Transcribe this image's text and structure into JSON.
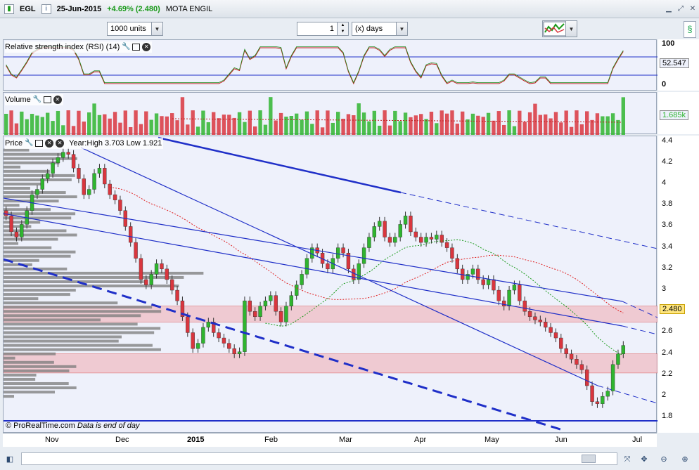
{
  "titlebar": {
    "symbol": "EGL",
    "date": "25-Jun-2015",
    "change": "+4.69% (2.480)",
    "name": "MOTA ENGIL",
    "info_icon": "i"
  },
  "toolbar": {
    "units_label": "1000 units",
    "period_value": "1",
    "period_unit": "(x) days"
  },
  "rsi": {
    "title": "Relative strength index (RSI) (14)",
    "axis_top": "100",
    "axis_bottom": "0",
    "current": "52.547"
  },
  "volume": {
    "title": "Volume",
    "current": "1.685k"
  },
  "price": {
    "title": "Price",
    "year_range": "Year:High 3.703 Low 1.921",
    "current": "2.480",
    "ticks": [
      "4.4",
      "4.2",
      "4",
      "3.8",
      "3.6",
      "3.4",
      "3.2",
      "3",
      "2.8",
      "2.6",
      "2.4",
      "2.2",
      "2",
      "1.8"
    ]
  },
  "footnote": {
    "source": "© ProRealTime.com",
    "note": "Data is end of day"
  },
  "xaxis": {
    "labels": [
      "Nov",
      "Dec",
      "2015",
      "Feb",
      "Mar",
      "Apr",
      "May",
      "Jun",
      "Jul"
    ]
  },
  "colors": {
    "up": "#2fb52f",
    "down": "#d9363e",
    "trend": "#1f2fc8",
    "zone": "#f0c4cc",
    "profile": "#7a7a7a"
  },
  "chart_data": {
    "type": "candlestick",
    "y_range": [
      1.65,
      4.45
    ],
    "levels": [
      2.85,
      2.7,
      2.4,
      2.22
    ],
    "year_high": 3.703,
    "year_low": 1.921,
    "last": 2.48,
    "closes": [
      3.7,
      3.55,
      3.5,
      3.62,
      3.75,
      3.9,
      3.95,
      4.05,
      4.1,
      4.2,
      4.25,
      4.3,
      4.28,
      4.15,
      4.05,
      3.9,
      3.95,
      4.1,
      4.15,
      4.0,
      3.9,
      3.85,
      3.75,
      3.6,
      3.45,
      3.3,
      3.1,
      3.05,
      3.15,
      3.25,
      3.2,
      3.1,
      3.0,
      2.9,
      2.75,
      2.6,
      2.45,
      2.5,
      2.65,
      2.7,
      2.6,
      2.55,
      2.5,
      2.45,
      2.4,
      2.42,
      2.9,
      2.8,
      2.75,
      2.85,
      2.9,
      2.95,
      2.8,
      2.7,
      2.85,
      2.95,
      3.05,
      3.15,
      3.3,
      3.4,
      3.35,
      3.25,
      3.2,
      3.3,
      3.4,
      3.35,
      3.2,
      3.1,
      3.25,
      3.4,
      3.5,
      3.6,
      3.65,
      3.5,
      3.45,
      3.5,
      3.62,
      3.7,
      3.55,
      3.5,
      3.45,
      3.5,
      3.48,
      3.52,
      3.45,
      3.4,
      3.3,
      3.2,
      3.1,
      3.15,
      3.2,
      3.1,
      3.05,
      3.1,
      3.0,
      2.9,
      2.85,
      3.0,
      3.05,
      2.9,
      2.8,
      2.75,
      2.72,
      2.7,
      2.65,
      2.6,
      2.55,
      2.45,
      2.4,
      2.35,
      2.3,
      2.25,
      2.1,
      1.95,
      1.93,
      2.0,
      2.05,
      2.3,
      2.4,
      2.48
    ]
  }
}
